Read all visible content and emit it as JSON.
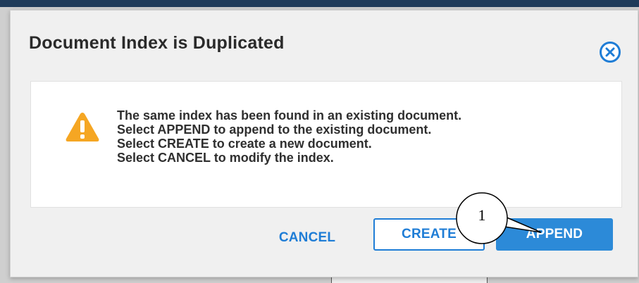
{
  "dialog": {
    "title": "Document Index is Duplicated",
    "close_icon": "close-circle-icon",
    "message_icon": "warning-triangle-icon",
    "message_lines": [
      "The same index has been found in an existing document.",
      "Select APPEND to append to the existing document.",
      "Select CREATE to create a new document.",
      "Select CANCEL to modify the index."
    ],
    "buttons": {
      "cancel": "CANCEL",
      "create": "CREATE",
      "append": "APPEND"
    }
  },
  "callout": {
    "number": "1"
  },
  "colors": {
    "accent": "#1f7dd6",
    "primary_button": "#2c8ad8",
    "warning": "#f5a623"
  }
}
